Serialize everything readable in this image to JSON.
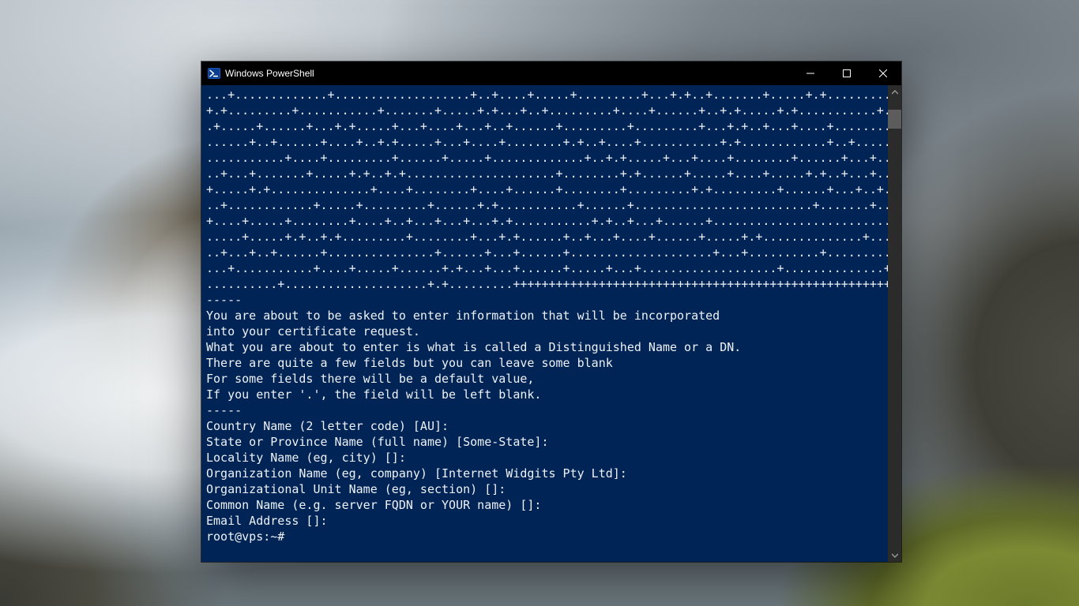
{
  "window": {
    "title": "Windows PowerShell",
    "icon_name": "powershell-icon"
  },
  "colors": {
    "terminal_bg": "#012456",
    "terminal_fg": "#eef2f6",
    "titlebar_bg": "#000000"
  },
  "terminal": {
    "lines": [
      "...+.............+...................+..+....+.....+.........+...+.+..+.......+.....+.+.....................+..+",
      "+.+.........+...........+.......+.....+.+...+..+.........+....+......+..+.+.....+.+...........+.+...+...+......+",
      ".+.....+......+...+.+.....+...+....+...+..+......+.........+.........+...+.+..+...+....+....................+.+.",
      "......+..+......+....+..+.+.....+...+....+........+.+..+....+...........+.+............+..+.........+....+.....+",
      "...........+....+.........+......+.....+.............+..+.+.....+...+....+........+......+...+......+.+.....+...",
      "..+...+.......+.....+.+..+.+.....................+........+.+......+.....+....+.....+.+..+...+......+....+......",
      "+.....+.+..............+....+........+....+......+........+.........+.+.........+......+...+..+...+.............",
      "..+............+.....+.........+......+.+...........+......+.........................+.......+......+...+....+..",
      "+....+.....+........+....+..+...+...+...+.+...........+.+..+...+......+.........................+............+.+",
      ".....+.....+.+..+.+.........+........+...+.+......+..+...+....+......+.....+.+..............+......+...+.+..+.+.",
      "..+...+..+......+...............+......+...+......+....................+...+..........+.....................+...",
      "...+...........+....+.....+......+.+...+...+......+.....+...+...................+..............+.+......+.....+.",
      "..........+....................+.+.........++++++++++++++++++++++++++++++++++++++++++++++++++++++++++++++++++++*",
      "-----",
      "You are about to be asked to enter information that will be incorporated",
      "into your certificate request.",
      "What you are about to enter is what is called a Distinguished Name or a DN.",
      "There are quite a few fields but you can leave some blank",
      "For some fields there will be a default value,",
      "If you enter '.', the field will be left blank.",
      "-----",
      "Country Name (2 letter code) [AU]:",
      "State or Province Name (full name) [Some-State]:",
      "Locality Name (eg, city) []:",
      "Organization Name (eg, company) [Internet Widgits Pty Ltd]:",
      "Organizational Unit Name (eg, section) []:",
      "Common Name (e.g. server FQDN or YOUR name) []:",
      "Email Address []:",
      "root@vps:~#"
    ]
  }
}
